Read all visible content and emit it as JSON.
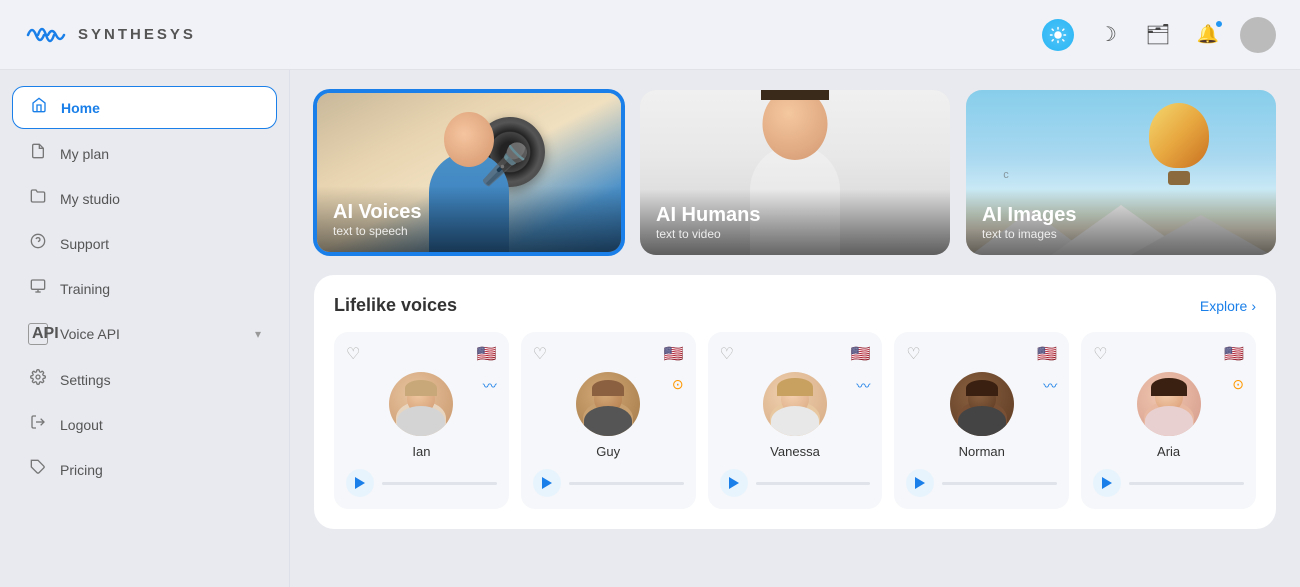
{
  "app": {
    "name": "SYNTHESYS"
  },
  "header": {
    "icons": {
      "sun": "☀",
      "moon": "☽",
      "folder": "🗂",
      "bell": "🔔"
    }
  },
  "sidebar": {
    "items": [
      {
        "id": "home",
        "label": "Home",
        "icon": "⌂",
        "active": true
      },
      {
        "id": "my-plan",
        "label": "My plan",
        "icon": "📄",
        "active": false
      },
      {
        "id": "my-studio",
        "label": "My studio",
        "icon": "🗂",
        "active": false
      },
      {
        "id": "support",
        "label": "Support",
        "icon": "?",
        "active": false
      },
      {
        "id": "training",
        "label": "Training",
        "icon": "🖥",
        "active": false
      },
      {
        "id": "voice-api",
        "label": "Voice API",
        "icon": "API",
        "active": false,
        "hasChevron": true
      },
      {
        "id": "settings",
        "label": "Settings",
        "icon": "⚙",
        "active": false
      },
      {
        "id": "logout",
        "label": "Logout",
        "icon": "→",
        "active": false
      },
      {
        "id": "pricing",
        "label": "Pricing",
        "icon": "◇",
        "active": false
      }
    ]
  },
  "feature_cards": [
    {
      "id": "ai-voices",
      "title": "AI Voices",
      "subtitle": "text to speech",
      "active": true,
      "bg_type": "voices"
    },
    {
      "id": "ai-humans",
      "title": "AI Humans",
      "subtitle": "text to video",
      "active": false,
      "bg_type": "humans"
    },
    {
      "id": "ai-images",
      "title": "AI Images",
      "subtitle": "text to images",
      "active": false,
      "bg_type": "images"
    }
  ],
  "voices_section": {
    "title": "Lifelike voices",
    "explore_label": "Explore",
    "explore_arrow": "›",
    "voices": [
      {
        "id": "ian",
        "name": "Ian",
        "flag": "🇺🇸",
        "indicator": "wave",
        "avatar_class": "avatar-ian"
      },
      {
        "id": "guy",
        "name": "Guy",
        "flag": "🇺🇸",
        "indicator": "loop",
        "avatar_class": "avatar-guy"
      },
      {
        "id": "vanessa",
        "name": "Vanessa",
        "flag": "🇺🇸",
        "indicator": "wave",
        "avatar_class": "avatar-vanessa"
      },
      {
        "id": "norman",
        "name": "Norman",
        "flag": "🇺🇸",
        "indicator": "wave",
        "avatar_class": "avatar-norman"
      },
      {
        "id": "aria",
        "name": "Aria",
        "flag": "🇺🇸",
        "indicator": "loop",
        "avatar_class": "avatar-aria"
      }
    ]
  }
}
